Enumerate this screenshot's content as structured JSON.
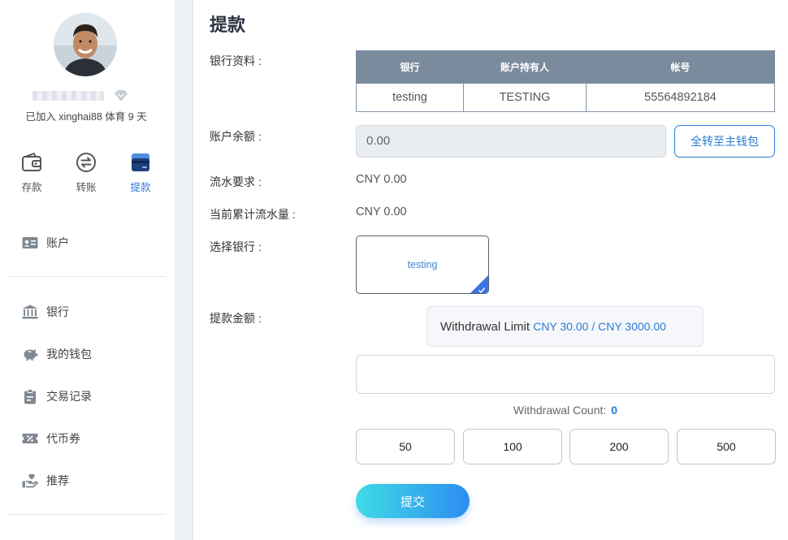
{
  "profile": {
    "joined_text": "已加入 xinghai88 体育 9 天"
  },
  "quick_actions": [
    {
      "label": "存款",
      "icon": "wallet-icon"
    },
    {
      "label": "转账",
      "icon": "transfer-icon"
    },
    {
      "label": "提款",
      "icon": "card-icon",
      "active": true
    }
  ],
  "menu": [
    {
      "label": "账户",
      "icon": "id-card-icon"
    },
    {
      "label": "银行",
      "icon": "bank-icon"
    },
    {
      "label": "我的钱包",
      "icon": "piggy-bank-icon"
    },
    {
      "label": "交易记录",
      "icon": "clipboard-icon"
    },
    {
      "label": "代币券",
      "icon": "ticket-icon"
    },
    {
      "label": "推荐",
      "icon": "hand-heart-icon"
    }
  ],
  "page": {
    "title": "提款"
  },
  "form": {
    "bank_info_label": "银行资料 :",
    "bank_table": {
      "headers": [
        "银行",
        "账户持有人",
        "帐号"
      ],
      "row": [
        "testing",
        "TESTING",
        "55564892184"
      ]
    },
    "balance_label": "账户余额 :",
    "balance_value": "0.00",
    "transfer_all_label": "全转至主钱包",
    "turnover_req_label": "流水要求 :",
    "turnover_req_value": "CNY 0.00",
    "turnover_acc_label": "当前累计流水量 :",
    "turnover_acc_value": "CNY 0.00",
    "select_bank_label": "选择银行 :",
    "selected_bank": "testing",
    "amount_label": "提款金额 :",
    "withdrawal_limit_label": "Withdrawal Limit",
    "withdrawal_limit_value": "CNY 30.00 / CNY 3000.00",
    "amount_input_value": "",
    "withdrawal_count_label": "Withdrawal Count:",
    "withdrawal_count_value": "0",
    "quick_amounts": [
      "50",
      "100",
      "200",
      "500"
    ],
    "submit_label": "提交"
  },
  "colors": {
    "accent": "#2d7bd5",
    "table_header": "#7b8b9e",
    "submit_gradient_start": "#3fdbe6",
    "submit_gradient_end": "#2d8df0"
  }
}
